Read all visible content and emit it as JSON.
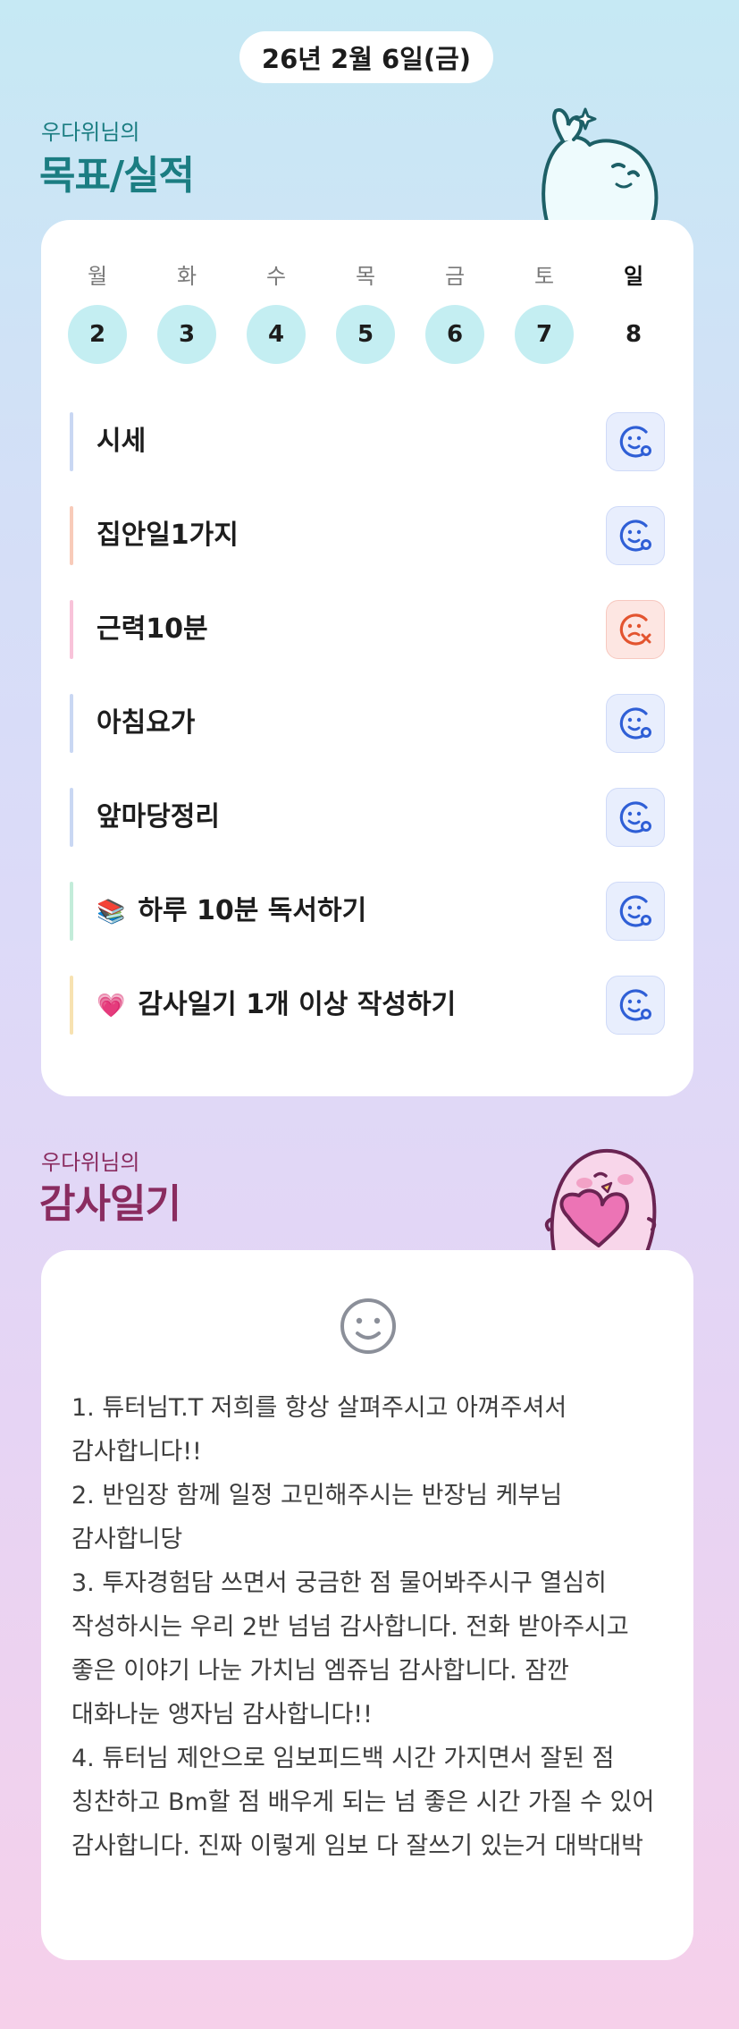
{
  "date": "26년 2월 6일(금)",
  "goals_section": {
    "subtitle": "우다위님의",
    "title": "목표/실적"
  },
  "week": [
    {
      "name": "월",
      "num": "2",
      "filled": true
    },
    {
      "name": "화",
      "num": "3",
      "filled": true
    },
    {
      "name": "수",
      "num": "4",
      "filled": true
    },
    {
      "name": "목",
      "num": "5",
      "filled": true
    },
    {
      "name": "금",
      "num": "6",
      "filled": true
    },
    {
      "name": "토",
      "num": "7",
      "filled": true
    },
    {
      "name": "일",
      "num": "8",
      "filled": false
    }
  ],
  "goals": [
    {
      "label": "시세",
      "emoji": "",
      "bar_color": "#c9d7f3",
      "status": "done"
    },
    {
      "label": "집안일1가지",
      "emoji": "",
      "bar_color": "#f8cbb9",
      "status": "done"
    },
    {
      "label": "근력10분",
      "emoji": "",
      "bar_color": "#f8c3d9",
      "status": "missed"
    },
    {
      "label": "아침요가",
      "emoji": "",
      "bar_color": "#c9d7f3",
      "status": "done"
    },
    {
      "label": "앞마당정리",
      "emoji": "",
      "bar_color": "#c9d7f3",
      "status": "done"
    },
    {
      "label": "하루 10분 독서하기",
      "emoji": "📚",
      "bar_color": "#c3ecd9",
      "status": "done"
    },
    {
      "label": "감사일기 1개 이상 작성하기",
      "emoji": "💗",
      "bar_color": "#f7e2b1",
      "status": "done"
    }
  ],
  "diary_section": {
    "subtitle": "우다위님의",
    "title": "감사일기"
  },
  "diary": {
    "icon": "smiley-icon",
    "text": "1. 튜터님T.T 저희를 항상 살펴주시고 아껴주셔서 감사합니다!!\n2. 반임장 함께 일정 고민해주시는 반장님 케부님 감사합니당\n3. 투자경험담 쓰면서 궁금한 점 물어봐주시구 열심히 작성하시는 우리 2반 넘넘 감사합니다. 전화 받아주시고 좋은 이야기 나눈 가치님 엠쥬님 감사합니다. 잠깐 대화나눈 앵자님 감사합니다!!\n4. 튜터님 제안으로 임보피드백 시간 가지면서 잘된 점 칭찬하고 Bm할 점 배우게 되는 넘 좋은 시간 가질 수 있어 감사합니다. 진짜 이렇게 임보 다 잘쓰기 있는거 대박대박"
  },
  "colors": {
    "goal_title": "#1b7d82",
    "diary_title": "#8a2c60",
    "done_icon": "#2f5fd6",
    "missed_icon": "#e3542f",
    "today_circle": "#c4eef2"
  }
}
